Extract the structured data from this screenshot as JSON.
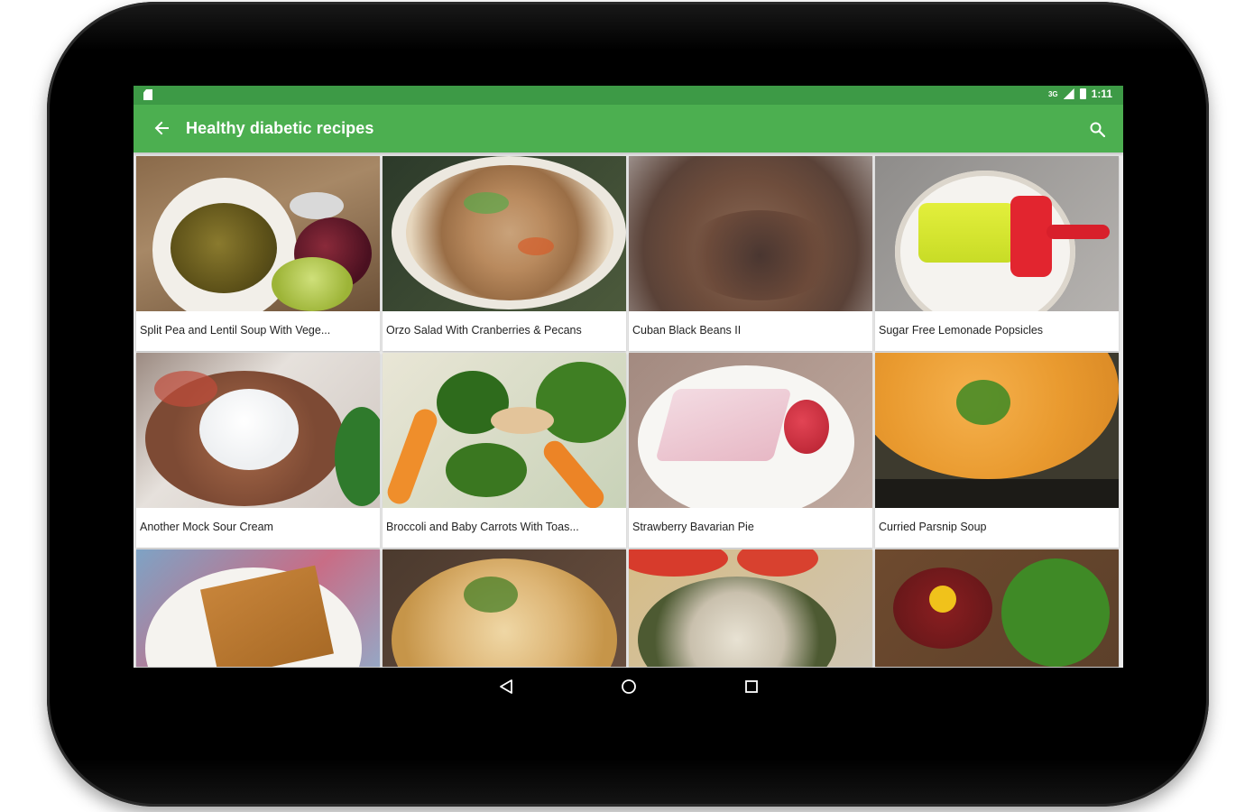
{
  "status_bar": {
    "time": "1:11",
    "network": "3G",
    "icons": [
      "sd-card-icon",
      "signal-icon",
      "battery-icon"
    ]
  },
  "app_bar": {
    "title": "Healthy diabetic recipes",
    "back_icon": "arrow-back-icon",
    "search_icon": "search-icon",
    "color": "#4caf50",
    "status_color": "#3d9a46"
  },
  "recipes": [
    {
      "title": "Split Pea and Lentil Soup With Vege..."
    },
    {
      "title": "Orzo Salad With Cranberries & Pecans"
    },
    {
      "title": "Cuban Black Beans II"
    },
    {
      "title": "Sugar Free Lemonade Popsicles"
    },
    {
      "title": "Another Mock Sour Cream"
    },
    {
      "title": "Broccoli and Baby Carrots With Toas..."
    },
    {
      "title": "Strawberry Bavarian Pie"
    },
    {
      "title": "Curried Parsnip Soup"
    },
    {
      "title": ""
    },
    {
      "title": ""
    },
    {
      "title": ""
    },
    {
      "title": ""
    }
  ],
  "nav_bar": {
    "icons": [
      "nav-back-icon",
      "nav-home-icon",
      "nav-recents-icon"
    ]
  }
}
